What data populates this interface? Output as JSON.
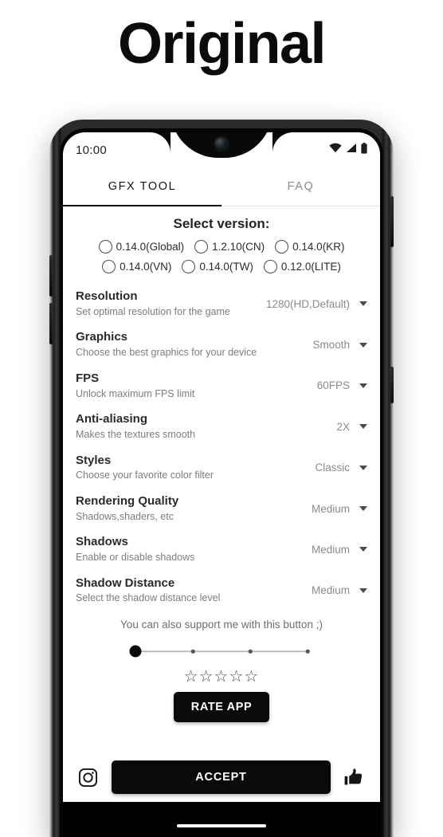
{
  "page": {
    "title": "Original"
  },
  "phone": {
    "status_bar": {
      "clock": "10:00",
      "icons": [
        "wifi-icon",
        "signal-icon",
        "battery-icon"
      ]
    },
    "navigation": {
      "gesture_pill": "gesture-pill"
    }
  },
  "tabs": [
    {
      "label": "GFX TOOL",
      "active": true
    },
    {
      "label": "FAQ",
      "active": false
    }
  ],
  "version_section": {
    "title": "Select version:",
    "rows": [
      [
        {
          "label": "0.14.0(Global)",
          "selected": false
        },
        {
          "label": "1.2.10(CN)",
          "selected": false
        },
        {
          "label": "0.14.0(KR)",
          "selected": false
        }
      ],
      [
        {
          "label": "0.14.0(VN)",
          "selected": false
        },
        {
          "label": "0.14.0(TW)",
          "selected": false
        },
        {
          "label": "0.12.0(LITE)",
          "selected": false
        }
      ]
    ]
  },
  "settings": [
    {
      "title": "Resolution",
      "subtitle": "Set optimal resolution for the game",
      "value": "1280(HD,Default)"
    },
    {
      "title": "Graphics",
      "subtitle": "Choose the best graphics for your device",
      "value": "Smooth"
    },
    {
      "title": "FPS",
      "subtitle": "Unlock maximum FPS limit",
      "value": "60FPS"
    },
    {
      "title": "Anti-aliasing",
      "subtitle": "Makes the textures smooth",
      "value": "2X"
    },
    {
      "title": "Styles",
      "subtitle": "Choose your favorite color filter",
      "value": "Classic"
    },
    {
      "title": "Rendering Quality",
      "subtitle": "Shadows,shaders, etc",
      "value": "Medium"
    },
    {
      "title": "Shadows",
      "subtitle": "Enable or disable shadows",
      "value": "Medium"
    },
    {
      "title": "Shadow Distance",
      "subtitle": "Select the shadow distance level",
      "value": "Medium"
    }
  ],
  "support": {
    "text": "You can also support me with this button ;)",
    "slider": {
      "positions": 4,
      "value_index": 0
    },
    "stars": "☆☆☆☆☆",
    "rate_button": "RATE APP"
  },
  "bottom_bar": {
    "instagram_icon": "instagram-icon",
    "accept_button": "ACCEPT",
    "thumbs_up_icon": "thumbs-up-icon"
  },
  "colors": {
    "accent": "#0a0a0a",
    "muted": "#8b8b8b",
    "title": "#2b2b2b"
  }
}
